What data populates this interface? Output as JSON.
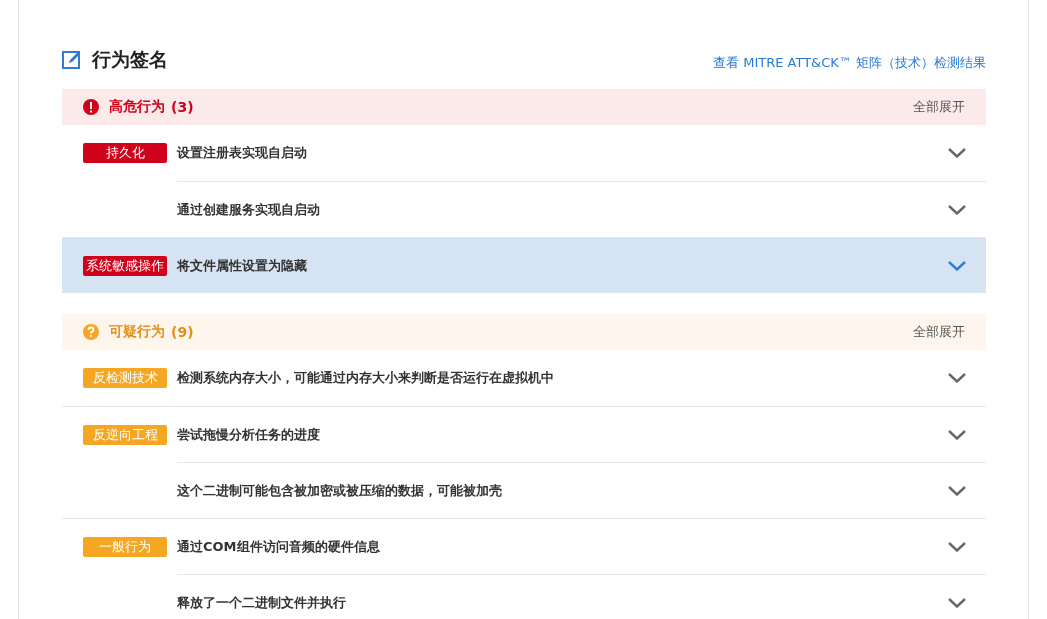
{
  "section": {
    "title": "行为签名",
    "link": "查看 MITRE ATT&CK™ 矩阵（技术）检测结果"
  },
  "groups": [
    {
      "kind": "danger",
      "title": "高危行为",
      "count": "(3)",
      "expand_all": "全部展开",
      "categories": [
        {
          "tag": "持久化",
          "items": [
            {
              "text": "设置注册表实现自启动",
              "selected": false
            },
            {
              "text": "通过创建服务实现自启动",
              "selected": false
            }
          ]
        },
        {
          "tag": "系统敏感操作",
          "items": [
            {
              "text": "将文件属性设置为隐藏",
              "selected": true
            }
          ]
        }
      ]
    },
    {
      "kind": "warning",
      "title": "可疑行为",
      "count": "(9)",
      "expand_all": "全部展开",
      "categories": [
        {
          "tag": "反检测技术",
          "items": [
            {
              "text": "检测系统内存大小，可能通过内存大小来判断是否运行在虚拟机中",
              "selected": false
            }
          ]
        },
        {
          "tag": "反逆向工程",
          "items": [
            {
              "text": "尝试拖慢分析任务的进度",
              "selected": false
            },
            {
              "text": "这个二进制可能包含被加密或被压缩的数据，可能被加壳",
              "selected": false
            }
          ]
        },
        {
          "tag": "一般行为",
          "items": [
            {
              "text": "通过COM组件访问音频的硬件信息",
              "selected": false
            },
            {
              "text": "释放了一个二进制文件并执行",
              "selected": false
            }
          ]
        }
      ]
    }
  ]
}
